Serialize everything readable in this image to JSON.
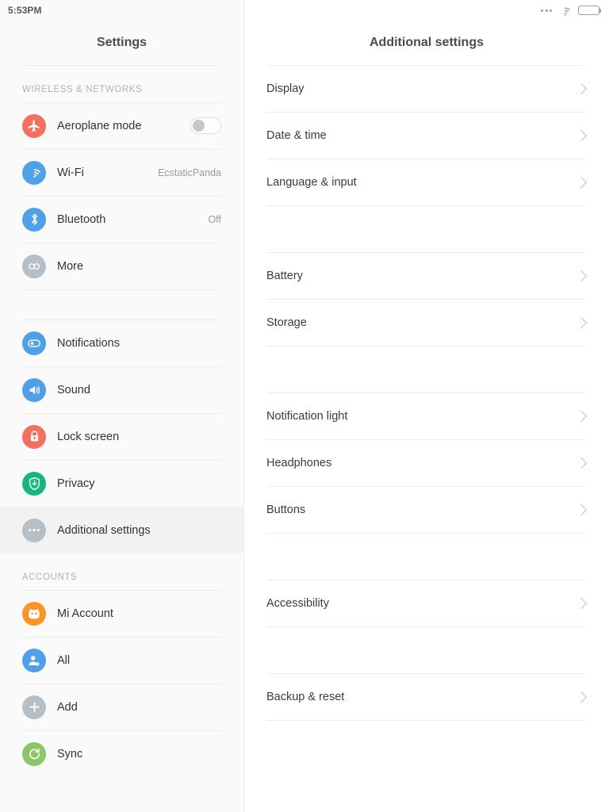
{
  "status_bar": {
    "time": "5:53PM",
    "icons": [
      "more-dots-icon",
      "wifi-icon",
      "battery-icon"
    ]
  },
  "colors": {
    "sidebar_bg": "#fafafa",
    "selected_bg": "#f2f2f2",
    "divider": "#ececec",
    "icon_red": "#f4705e",
    "icon_blue": "#4fa0e8",
    "icon_gray": "#b6bfc6",
    "icon_green": "#14b87c",
    "icon_orange": "#ff9326",
    "icon_lightgreen": "#8cc665",
    "text_primary": "#333333",
    "text_secondary": "#9a9a9a",
    "group_label": "#b3b3b3"
  },
  "sidebar": {
    "title": "Settings",
    "sections": [
      {
        "label": "WIRELESS & NETWORKS",
        "items": [
          {
            "label": "Aeroplane mode",
            "icon": "aeroplane-icon",
            "color": "#f4705e",
            "control": "toggle",
            "toggle_on": false
          },
          {
            "label": "Wi-Fi",
            "icon": "wifi-icon",
            "color": "#4fa0e8",
            "value": "EcstaticPanda"
          },
          {
            "label": "Bluetooth",
            "icon": "bluetooth-icon",
            "color": "#4fa0e8",
            "value": "Off"
          },
          {
            "label": "More",
            "icon": "more-icon",
            "color": "#b6bfc6"
          }
        ]
      },
      {
        "label": "",
        "items": [
          {
            "label": "Notifications",
            "icon": "notifications-icon",
            "color": "#4fa0e8"
          },
          {
            "label": "Sound",
            "icon": "sound-icon",
            "color": "#4fa0e8"
          },
          {
            "label": "Lock screen",
            "icon": "lock-icon",
            "color": "#f4705e"
          },
          {
            "label": "Privacy",
            "icon": "privacy-shield-icon",
            "color": "#14b87c"
          },
          {
            "label": "Additional settings",
            "icon": "additional-settings-icon",
            "color": "#b6bfc6",
            "selected": true
          }
        ]
      },
      {
        "label": "ACCOUNTS",
        "items": [
          {
            "label": "Mi Account",
            "icon": "mi-account-icon",
            "color": "#ff9326"
          },
          {
            "label": "All",
            "icon": "all-accounts-icon",
            "color": "#4fa0e8"
          },
          {
            "label": "Add",
            "icon": "add-account-icon",
            "color": "#b6bfc6"
          },
          {
            "label": "Sync",
            "icon": "sync-icon",
            "color": "#8cc665"
          }
        ]
      }
    ]
  },
  "main": {
    "title": "Additional settings",
    "groups": [
      {
        "items": [
          {
            "label": "Display",
            "chevron": "chevron-right-icon"
          },
          {
            "label": "Date & time",
            "chevron": "chevron-right-icon"
          },
          {
            "label": "Language & input",
            "chevron": "chevron-right-icon"
          }
        ]
      },
      {
        "items": [
          {
            "label": "Battery",
            "chevron": "chevron-right-icon"
          },
          {
            "label": "Storage",
            "chevron": "chevron-right-icon"
          }
        ]
      },
      {
        "items": [
          {
            "label": "Notification light",
            "chevron": "chevron-right-icon"
          },
          {
            "label": "Headphones",
            "chevron": "chevron-right-icon"
          },
          {
            "label": "Buttons",
            "chevron": "chevron-right-icon"
          }
        ]
      },
      {
        "items": [
          {
            "label": "Accessibility",
            "chevron": "chevron-right-icon"
          }
        ]
      },
      {
        "items": [
          {
            "label": "Backup & reset",
            "chevron": "chevron-right-icon"
          }
        ]
      }
    ]
  }
}
